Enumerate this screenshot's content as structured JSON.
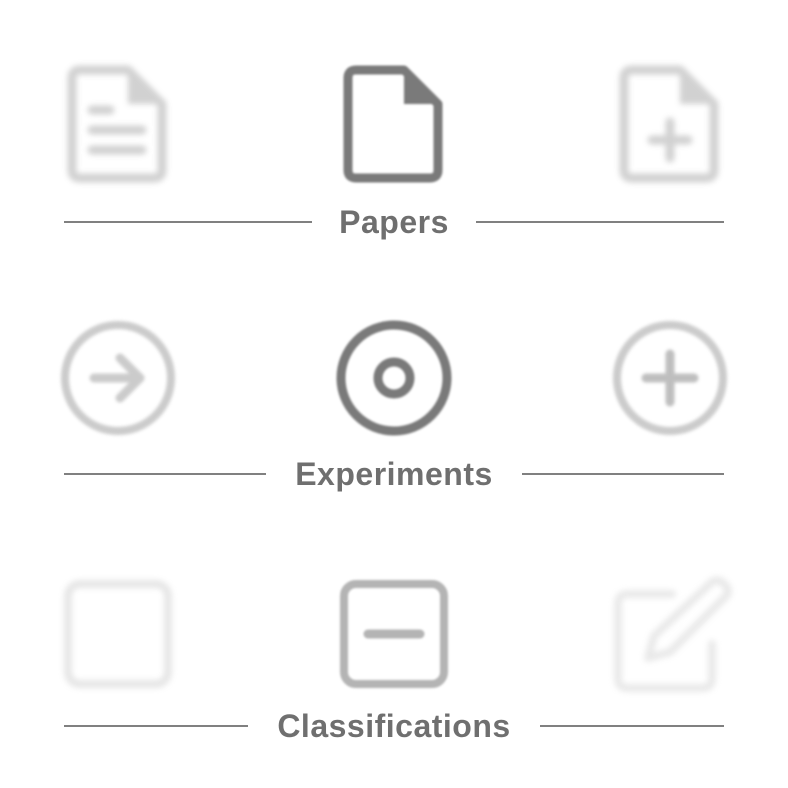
{
  "sections": [
    {
      "label": "Papers",
      "icons": [
        {
          "name": "document-text-icon",
          "state": "faded"
        },
        {
          "name": "document-icon",
          "state": "selected"
        },
        {
          "name": "document-add-icon",
          "state": "faded"
        }
      ]
    },
    {
      "label": "Experiments",
      "icons": [
        {
          "name": "arrow-circle-right-icon",
          "state": "faded"
        },
        {
          "name": "record-circle-icon",
          "state": "selected"
        },
        {
          "name": "plus-circle-icon",
          "state": "faded"
        }
      ]
    },
    {
      "label": "Classifications",
      "icons": [
        {
          "name": "square-icon",
          "state": "faded"
        },
        {
          "name": "minus-square-icon",
          "state": "selected"
        },
        {
          "name": "edit-square-icon",
          "state": "faded"
        }
      ]
    }
  ],
  "colors": {
    "background": "#ffffff",
    "label": "#6f6f6f",
    "divider": "#808080",
    "icon_selected": "#7a7a7a",
    "icon_faded": "#bcbcbc"
  }
}
